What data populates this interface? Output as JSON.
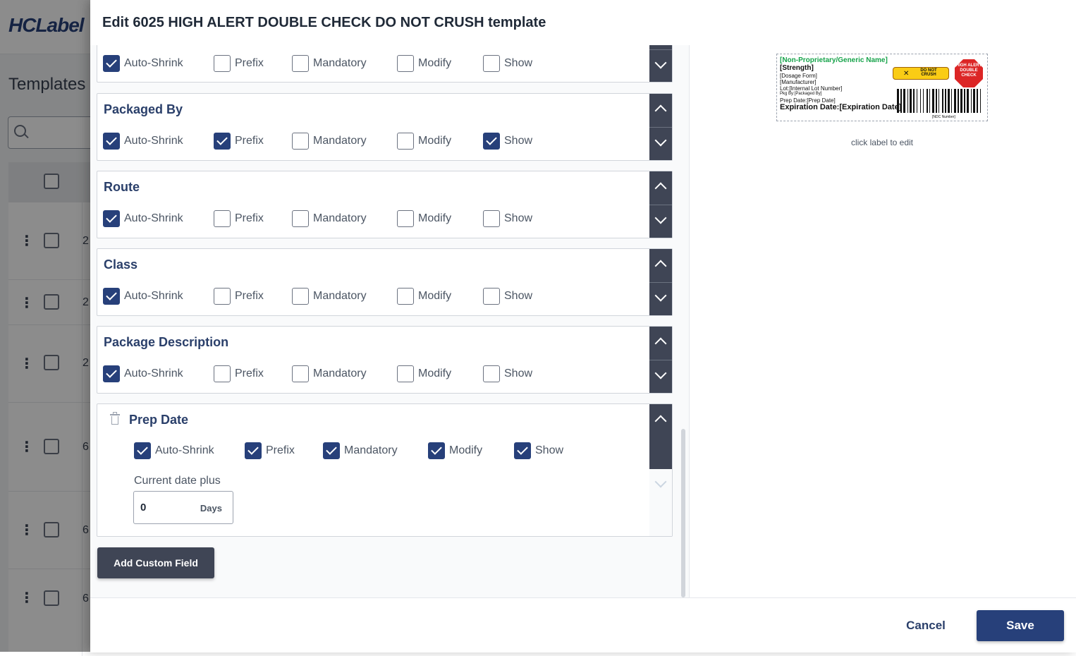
{
  "background": {
    "logo": "HCLabel",
    "page_title": "Templates",
    "row_cells": [
      "2",
      "2",
      "2",
      "6",
      "6",
      "6"
    ]
  },
  "modal": {
    "title": "Edit 6025 HIGH ALERT DOUBLE CHECK DO NOT CRUSH template",
    "option_labels": [
      "Auto-Shrink",
      "Prefix",
      "Mandatory",
      "Modify",
      "Show"
    ],
    "fields": [
      {
        "title": "",
        "options": {
          "auto_shrink": true,
          "prefix": false,
          "mandatory": false,
          "modify": false,
          "show": false
        }
      },
      {
        "title": "Packaged By",
        "options": {
          "auto_shrink": true,
          "prefix": true,
          "mandatory": false,
          "modify": false,
          "show": true
        }
      },
      {
        "title": "Route",
        "options": {
          "auto_shrink": true,
          "prefix": false,
          "mandatory": false,
          "modify": false,
          "show": false
        }
      },
      {
        "title": "Class",
        "options": {
          "auto_shrink": true,
          "prefix": false,
          "mandatory": false,
          "modify": false,
          "show": false
        }
      },
      {
        "title": "Package Description",
        "options": {
          "auto_shrink": true,
          "prefix": false,
          "mandatory": false,
          "modify": false,
          "show": false
        }
      },
      {
        "title": "Prep Date",
        "options": {
          "auto_shrink": true,
          "prefix": true,
          "mandatory": true,
          "modify": true,
          "show": true
        }
      }
    ],
    "prep_date": {
      "label": "Current date plus",
      "value": "0",
      "unit": "Days"
    },
    "add_custom_field": "Add Custom Field",
    "preview": {
      "generic_name": "[Non-Proprietary/Generic Name]",
      "strength": "[Strength]",
      "dosage_form": "[Dosage Form]",
      "manufacturer": "[Manufacturer]",
      "lot": "Lot:[Internal Lot Number]",
      "packaged_by": "Pkg By:[Packaged By]",
      "prep_date": "Prep Date:[Prep Date]",
      "expiration": "Expiration Date:[Expiration Date]",
      "do_not_crush": "DO NOT CRUSH",
      "high_alert": "HIGH ALERT DOUBLE CHECK",
      "ndc": "[NDC Number]",
      "hint": "click label to edit",
      "colors": {
        "generic": "#16a34a",
        "badge": "#facc15",
        "alert": "#dc2626"
      }
    },
    "footer": {
      "cancel": "Cancel",
      "save": "Save"
    }
  }
}
